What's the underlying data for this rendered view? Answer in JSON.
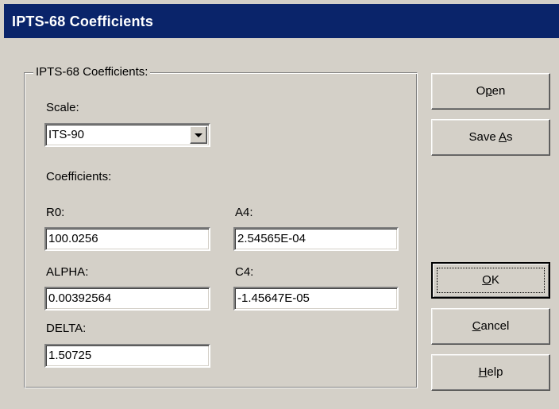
{
  "window": {
    "title": "IPTS-68 Coefficients"
  },
  "group": {
    "label": "IPTS-68 Coefficients:"
  },
  "scale": {
    "label": "Scale:",
    "value": "ITS-90"
  },
  "coefficients": {
    "label": "Coefficients:",
    "r0": {
      "label": "R0:",
      "value": "100.0256"
    },
    "alpha": {
      "label": "ALPHA:",
      "value": "0.00392564"
    },
    "delta": {
      "label": "DELTA:",
      "value": "1.50725"
    },
    "a4": {
      "label": "A4:",
      "value": "2.54565E-04"
    },
    "c4": {
      "label": "C4:",
      "value": "-1.45647E-05"
    }
  },
  "buttons": {
    "open": {
      "before": "O",
      "mnemonic": "p",
      "after": "en"
    },
    "save_as": {
      "before": "Save ",
      "mnemonic": "A",
      "after": "s"
    },
    "ok": {
      "before": "",
      "mnemonic": "O",
      "after": "K"
    },
    "cancel": {
      "before": "",
      "mnemonic": "C",
      "after": "ancel"
    },
    "help": {
      "before": "",
      "mnemonic": "H",
      "after": "elp"
    }
  },
  "colors": {
    "titlebar": "#0a246a",
    "dialog_face": "#d4d0c8",
    "field_bg": "#ffffff"
  },
  "icons": {
    "combo_dropdown": "chevron-down-icon"
  }
}
